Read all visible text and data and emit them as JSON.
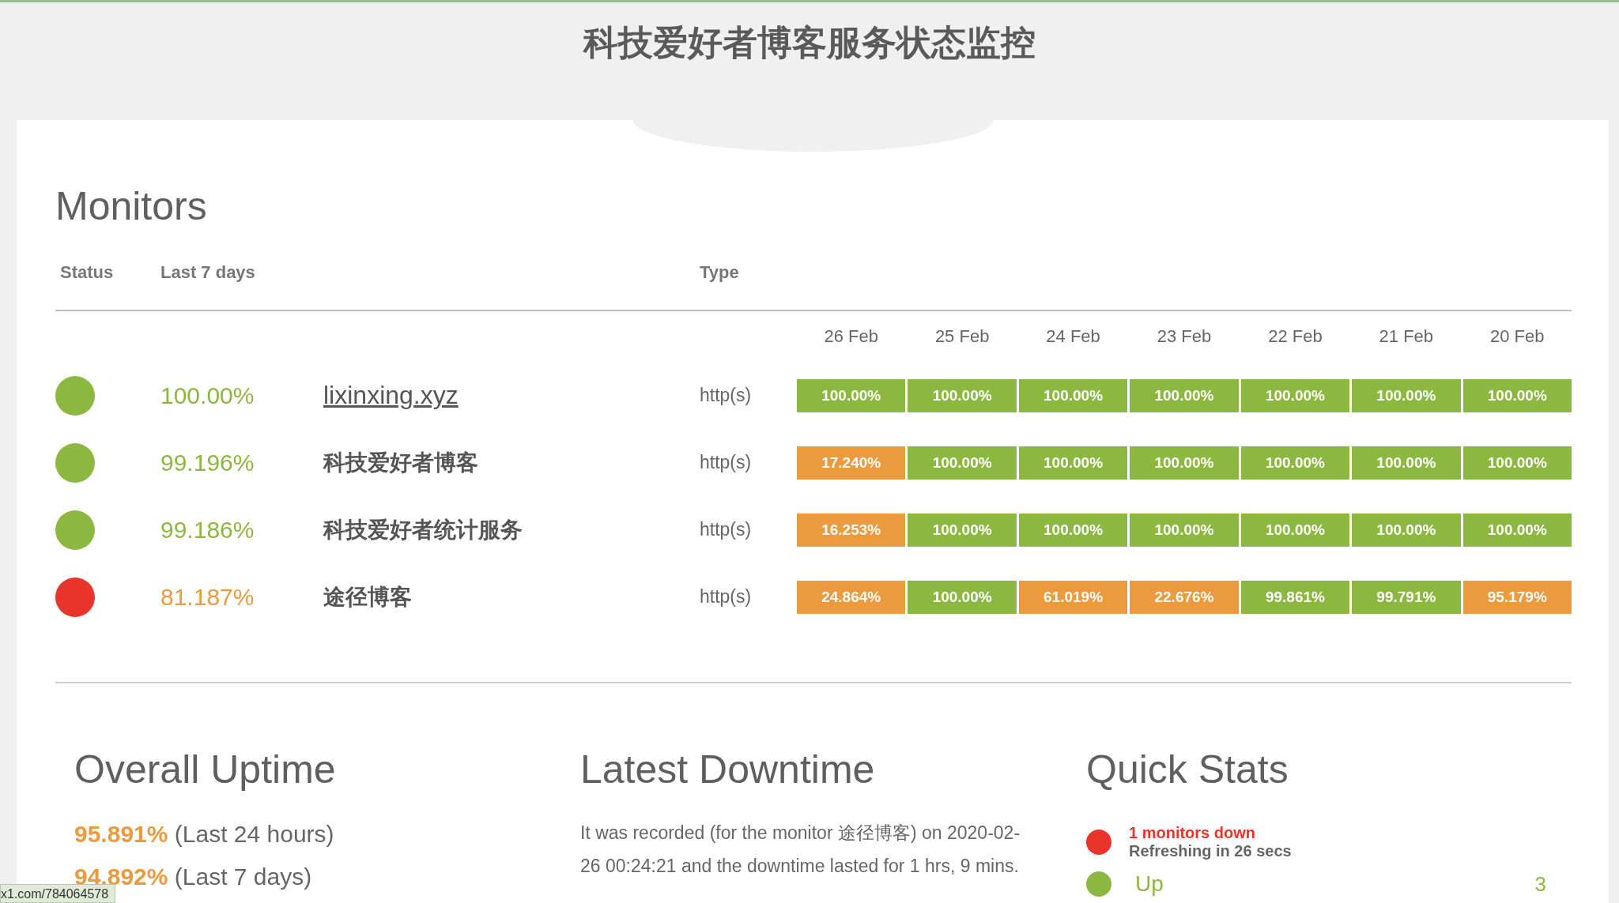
{
  "title": "科技爱好者博客服务状态监控",
  "monitors_heading": "Monitors",
  "columns": [
    "Status",
    "Last 7 days",
    "Type"
  ],
  "dates": [
    "26 Feb",
    "25 Feb",
    "24 Feb",
    "23 Feb",
    "22 Feb",
    "21 Feb",
    "20 Feb"
  ],
  "monitors": [
    {
      "color": "#8cb842",
      "uptime": {
        "value": "100.00%",
        "color": "#8cb842"
      },
      "name": "lixinxing.xyz",
      "link": true,
      "type": "http(s)",
      "days": [
        {
          "value": "100.00%",
          "color": "#8cb842"
        },
        {
          "value": "100.00%",
          "color": "#8cb842"
        },
        {
          "value": "100.00%",
          "color": "#8cb842"
        },
        {
          "value": "100.00%",
          "color": "#8cb842"
        },
        {
          "value": "100.00%",
          "color": "#8cb842"
        },
        {
          "value": "100.00%",
          "color": "#8cb842"
        },
        {
          "value": "100.00%",
          "color": "#8cb842"
        }
      ]
    },
    {
      "color": "#8cb842",
      "uptime": {
        "value": "99.196%",
        "color": "#8cb842"
      },
      "name": "科技爱好者博客",
      "link": false,
      "type": "http(s)",
      "days": [
        {
          "value": "17.240%",
          "color": "#ec9a3e"
        },
        {
          "value": "100.00%",
          "color": "#8cb842"
        },
        {
          "value": "100.00%",
          "color": "#8cb842"
        },
        {
          "value": "100.00%",
          "color": "#8cb842"
        },
        {
          "value": "100.00%",
          "color": "#8cb842"
        },
        {
          "value": "100.00%",
          "color": "#8cb842"
        },
        {
          "value": "100.00%",
          "color": "#8cb842"
        }
      ]
    },
    {
      "color": "#8cb842",
      "uptime": {
        "value": "99.186%",
        "color": "#8cb842"
      },
      "name": "科技爱好者统计服务",
      "link": false,
      "type": "http(s)",
      "days": [
        {
          "value": "16.253%",
          "color": "#ec9a3e"
        },
        {
          "value": "100.00%",
          "color": "#8cb842"
        },
        {
          "value": "100.00%",
          "color": "#8cb842"
        },
        {
          "value": "100.00%",
          "color": "#8cb842"
        },
        {
          "value": "100.00%",
          "color": "#8cb842"
        },
        {
          "value": "100.00%",
          "color": "#8cb842"
        },
        {
          "value": "100.00%",
          "color": "#8cb842"
        }
      ]
    },
    {
      "color": "#e8342a",
      "uptime": {
        "value": "81.187%",
        "color": "#ec9a3e"
      },
      "name": "途径博客",
      "link": false,
      "type": "http(s)",
      "days": [
        {
          "value": "24.864%",
          "color": "#ec9a3e"
        },
        {
          "value": "100.00%",
          "color": "#8cb842"
        },
        {
          "value": "61.019%",
          "color": "#ec9a3e"
        },
        {
          "value": "22.676%",
          "color": "#ec9a3e"
        },
        {
          "value": "99.861%",
          "color": "#8cb842"
        },
        {
          "value": "99.791%",
          "color": "#8cb842"
        },
        {
          "value": "95.179%",
          "color": "#ec9a3e"
        }
      ]
    }
  ],
  "overall_uptime": {
    "heading": "Overall Uptime",
    "entries": [
      {
        "value": "95.891%",
        "period": "(Last 24 hours)"
      },
      {
        "value": "94.892%",
        "period": "(Last 7 days)"
      }
    ]
  },
  "latest_downtime": {
    "heading": "Latest Downtime",
    "text": "It was recorded (for the monitor 途径博客) on 2020-02-26 00:24:21 and the downtime lasted for 1 hrs, 9 mins."
  },
  "quick_stats": {
    "heading": "Quick Stats",
    "alerts": [
      {
        "color": "#e8342a",
        "title": "1 monitors down",
        "detail": "Refreshing in 26 secs"
      }
    ],
    "counts": [
      {
        "color": "#8cb842",
        "label": "Up",
        "count": "3"
      }
    ]
  },
  "status_url": "x1.com/784064578"
}
